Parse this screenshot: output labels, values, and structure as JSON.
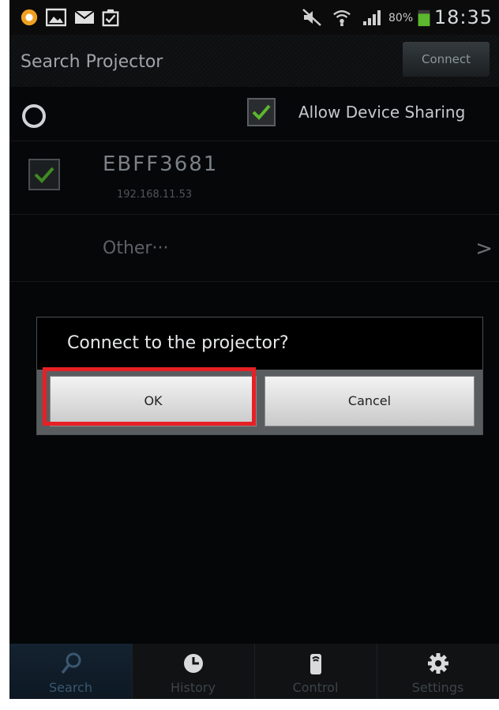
{
  "status_bar": {
    "time": "18:35",
    "battery_percent": "80%",
    "icons": [
      "notification-circle-icon",
      "image-icon",
      "mail-icon",
      "clipboard-check-icon",
      "mute-icon",
      "wifi-icon",
      "signal-icon",
      "battery-icon"
    ]
  },
  "app_bar": {
    "title": "Search Projector",
    "connect_label": "Connect"
  },
  "sharing_row": {
    "label": "Allow Device Sharing",
    "checked": true
  },
  "device": {
    "name": "EBFF3681",
    "ip": "192.168.11.53",
    "checked": true
  },
  "other_row": {
    "label": "Other···",
    "chevron": ">"
  },
  "dialog": {
    "title": "Connect to the projector?",
    "ok_label": "OK",
    "cancel_label": "Cancel"
  },
  "tabs": [
    {
      "label": "Search",
      "icon": "search-icon",
      "active": true
    },
    {
      "label": "History",
      "icon": "clock-icon",
      "active": false
    },
    {
      "label": "Control",
      "icon": "remote-icon",
      "active": false
    },
    {
      "label": "Settings",
      "icon": "gear-icon",
      "active": false
    }
  ],
  "colors": {
    "highlight": "#e62025",
    "check_green": "#5cb82e"
  }
}
